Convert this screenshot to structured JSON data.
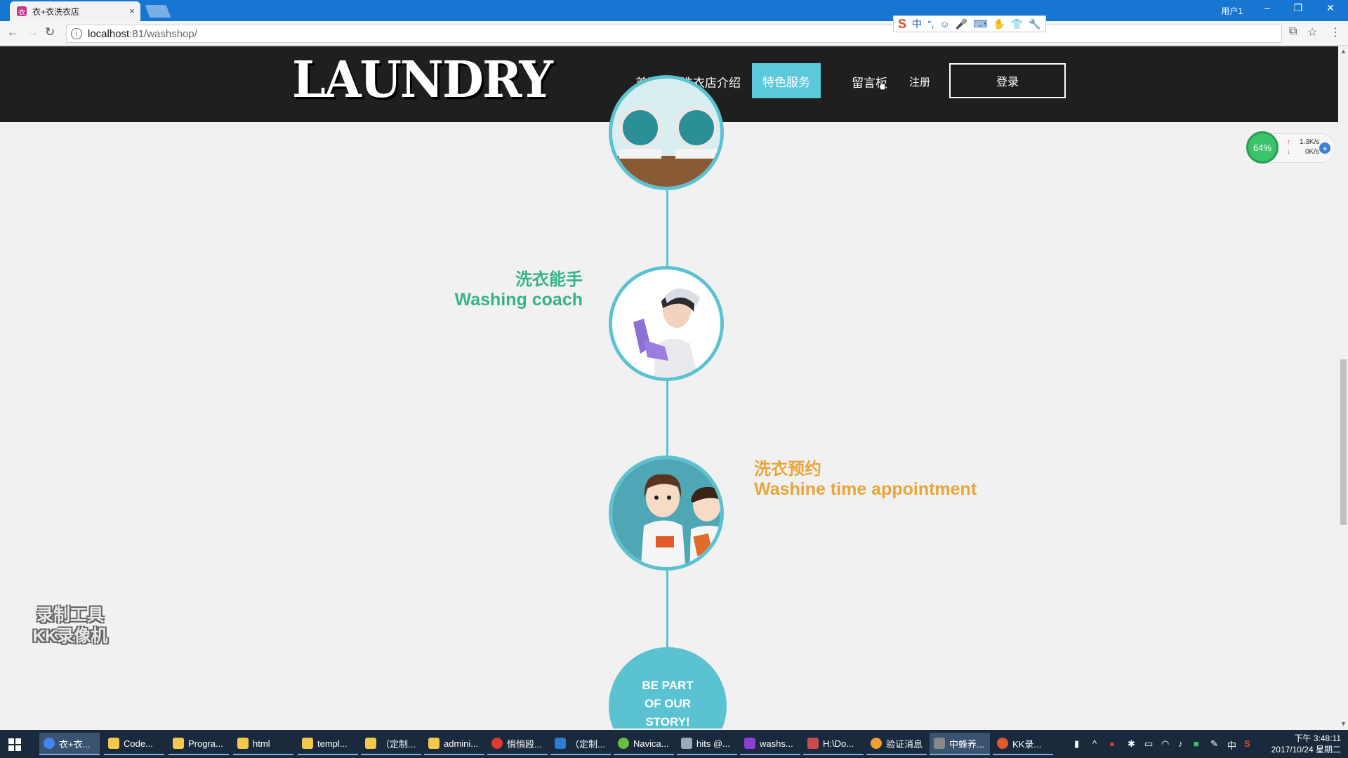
{
  "browser": {
    "tab_title": "衣+衣洗衣店",
    "tab_close": "×",
    "user_label": "用户1",
    "address_host": "localhost",
    "address_path": ":81/washshop/",
    "ime_items": [
      "S",
      "中",
      "°,",
      "☺",
      "🎤",
      "⌨",
      "✋",
      "👕",
      "🔧"
    ]
  },
  "site": {
    "logo": "LAUNDRY",
    "nav": {
      "home": "首页",
      "about": "洗衣店介绍",
      "services": "特色服务",
      "messages": "留言板",
      "register": "注册",
      "login": "登录"
    },
    "timeline": [
      {
        "title_cn": "洗衣能手",
        "title_en": "Washing coach",
        "color": "#36b38a"
      },
      {
        "title_cn": "洗衣预约",
        "title_en": "Washine time appointment",
        "color": "#e8a53a"
      }
    ],
    "cta": [
      "BE PART",
      "OF OUR",
      "STORY!"
    ],
    "accent": "#5bc2d2"
  },
  "overlay": {
    "net_percent": "64%",
    "net_up": "1.3K/s",
    "net_down": "0K/s",
    "watermark_line1": "录制工具",
    "watermark_line2": "KK录像机"
  },
  "taskbar": {
    "items": [
      "衣+衣...",
      "Code...",
      "Progra...",
      "html",
      "templ...",
      "（定制...",
      "admini...",
      "悄悄殴...",
      "（定制...",
      "Navica...",
      "hits @...",
      "washs...",
      "H:\\Do...",
      "验证消息",
      "中蜂养...",
      "KK录..."
    ],
    "clock_time": "下午 3:48:11",
    "clock_date": "2017/10/24 星期二",
    "ime_lang": "中"
  }
}
